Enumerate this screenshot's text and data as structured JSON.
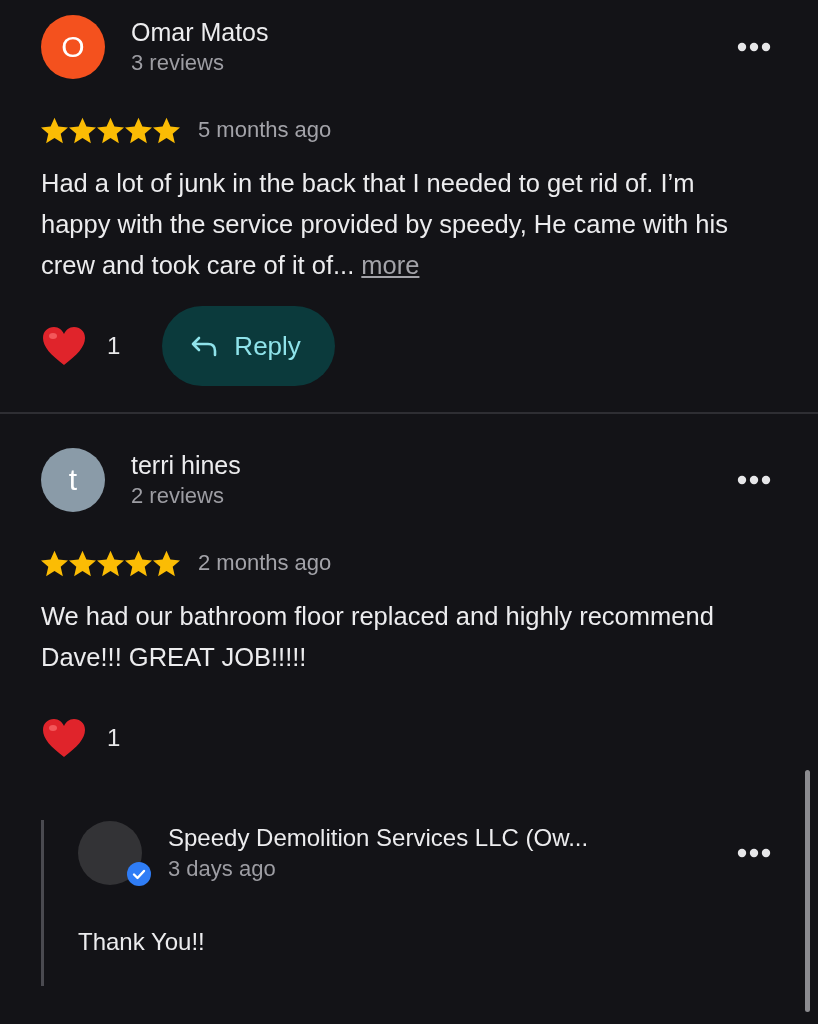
{
  "reviews": [
    {
      "avatar_letter": "O",
      "color": "#f4511e",
      "name": "Omar Matos",
      "review_count": "3 reviews",
      "stars": 5,
      "time": "5 months ago",
      "text": "Had a lot of junk in the back that I needed to get rid of. I’m happy with the service provided by speedy, He came with his crew and took care of it of...",
      "more_link": "more",
      "likes": "1",
      "reply_button": "Reply"
    },
    {
      "avatar_letter": "t",
      "color": "#8a9ba8",
      "name": "terri hines",
      "review_count": "2 reviews",
      "stars": 5,
      "time": "2 months ago",
      "text": "We had our bathroom floor replaced and highly recommend Dave!!!  GREAT JOB!!!!!",
      "likes": "1",
      "owner_reply": {
        "name": "Speedy Demolition Services LLC (Ow...",
        "time": "3 days ago",
        "verified": true,
        "text": "Thank You!!"
      }
    }
  ]
}
